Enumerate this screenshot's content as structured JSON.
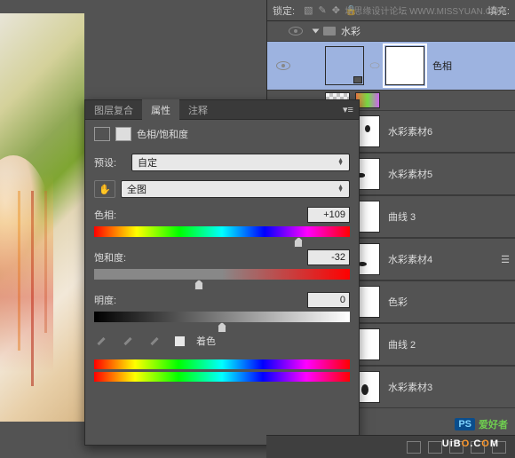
{
  "lock_row": {
    "label": "锁定:",
    "fill_label": "填充:"
  },
  "watermark": "填思缘设计论坛  WWW.MISSYUAN.COM",
  "group": {
    "name": "水彩"
  },
  "layers": [
    {
      "name": "色相",
      "active": true
    },
    {
      "name": "水彩素材6"
    },
    {
      "name": "水彩素材5"
    },
    {
      "name": "曲线 3"
    },
    {
      "name": "水彩素材4"
    },
    {
      "name": "色彩"
    },
    {
      "name": "曲线 2"
    },
    {
      "name": "水彩素材3"
    }
  ],
  "panel": {
    "tabs": [
      "图层复合",
      "属性",
      "注释"
    ],
    "title": "色相/饱和度",
    "preset_label": "预设:",
    "preset_value": "自定",
    "range_value": "全图",
    "hue": {
      "label": "色相:",
      "value": "+109",
      "pos": 80
    },
    "sat": {
      "label": "饱和度:",
      "value": "-32",
      "pos": 41
    },
    "bri": {
      "label": "明度:",
      "value": "0",
      "pos": 50
    },
    "colorize": "着色"
  },
  "logo": {
    "ps": "PS",
    "txt": "爱好者"
  },
  "uibo": {
    "p1": "UiB",
    "o": "O",
    "p2": ".C",
    "o2": "O",
    "p3": "M"
  }
}
